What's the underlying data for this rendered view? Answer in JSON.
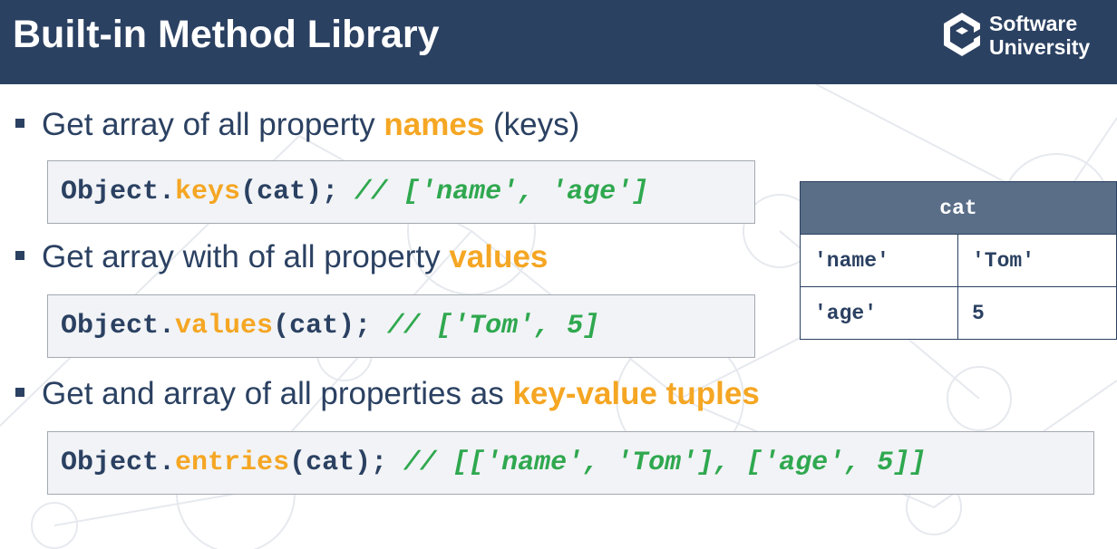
{
  "header": {
    "title": "Built-in Method Library",
    "logo_line1": "Software",
    "logo_line2": "University"
  },
  "bullets": [
    {
      "text_before": "Get array of all property ",
      "highlight": "names",
      "text_after": " (keys)",
      "code": {
        "object": "Object",
        "dot": ".",
        "method": "keys",
        "args": "(cat); ",
        "comment": "// ['name', 'age']"
      }
    },
    {
      "text_before": "Get array with of all property ",
      "highlight": "values",
      "text_after": "",
      "code": {
        "object": "Object",
        "dot": ".",
        "method": "values",
        "args": "(cat); ",
        "comment": "// ['Tom', 5]"
      }
    },
    {
      "text_before": "Get and array of all properties as ",
      "highlight": "key-value tuples",
      "text_after": "",
      "code": {
        "object": "Object",
        "dot": ".",
        "method": "entries",
        "args": "(cat); ",
        "comment": "// [['name', 'Tom'], ['age', 5]]"
      }
    }
  ],
  "cat_table": {
    "header": "cat",
    "rows": [
      [
        "'name'",
        "'Tom'"
      ],
      [
        "'age'",
        "5"
      ]
    ]
  },
  "colors": {
    "header_bg": "#2b4162",
    "highlight": "#f5a623",
    "comment": "#2fa84f",
    "table_header_bg": "#5a6e88"
  },
  "icons": [
    "software-university-logo-icon"
  ]
}
